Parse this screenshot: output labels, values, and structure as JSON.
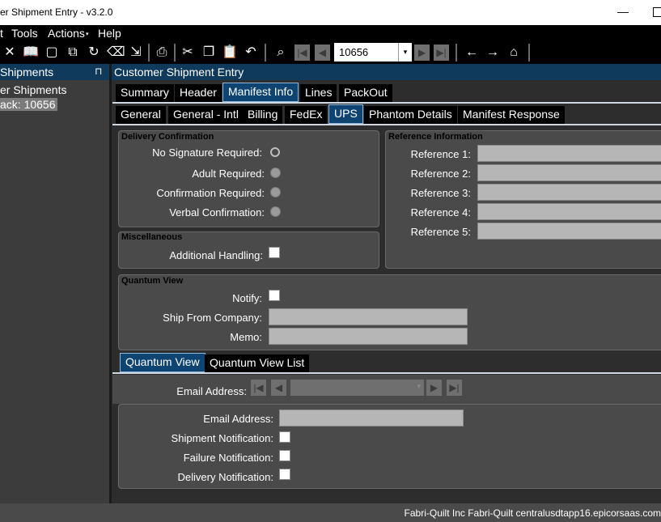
{
  "window": {
    "title": "er Shipment Entry - v3.2.0",
    "minimize": "—"
  },
  "menu": [
    "t",
    "Tools",
    "Actions",
    "Help"
  ],
  "toolbar": {
    "record_value": "10656",
    "dropdown_glyph": "▾"
  },
  "left_panel": {
    "title": "Shipments",
    "pin": "⊓",
    "tree_root": "er Shipments",
    "tree_item": "ack: 10656"
  },
  "main": {
    "title": "Customer Shipment Entry",
    "tabs": [
      "Summary",
      "Header",
      "Manifest Info",
      "Lines",
      "PackOut"
    ],
    "selected_tab": "Manifest Info",
    "subtabs": [
      "General",
      "General - Intl",
      "Billing",
      "FedEx",
      "UPS",
      "Phantom Details",
      "Manifest Response"
    ],
    "selected_subtab": "UPS"
  },
  "delivery_confirmation": {
    "title": "Delivery Confirmation",
    "options": [
      "No Signature Required:",
      "Adult Required:",
      "Confirmation Required:",
      "Verbal Confirmation:"
    ],
    "selected": "No Signature Required:"
  },
  "miscellaneous": {
    "title": "Miscellaneous",
    "additional_handling": "Additional Handling:"
  },
  "reference_information": {
    "title": "Reference Information",
    "labels": [
      "Reference 1:",
      "Reference 2:",
      "Reference 3:",
      "Reference 4:",
      "Reference 5:"
    ]
  },
  "quantum_view": {
    "title": "Quantum View",
    "notify": "Notify:",
    "ship_from_company": "Ship From Company:",
    "memo": "Memo:"
  },
  "quantum_tabs": [
    "Quantum View",
    "Quantum View List"
  ],
  "email_nav": {
    "label": "Email Address:"
  },
  "email_detail": {
    "email_address": "Email Address:",
    "shipment_notification": "Shipment Notification:",
    "failure_notification": "Failure Notification:",
    "delivery_notification": "Delivery Notification:"
  },
  "status": {
    "text": "Fabri-Quilt Inc  Fabri-Quilt  centralusdtapp16.epicorsaas.com"
  },
  "colors": {
    "header_blue": "#0f3a5c",
    "selected_tab": "#0e4471",
    "panel_gray": "#4a4a4a"
  }
}
